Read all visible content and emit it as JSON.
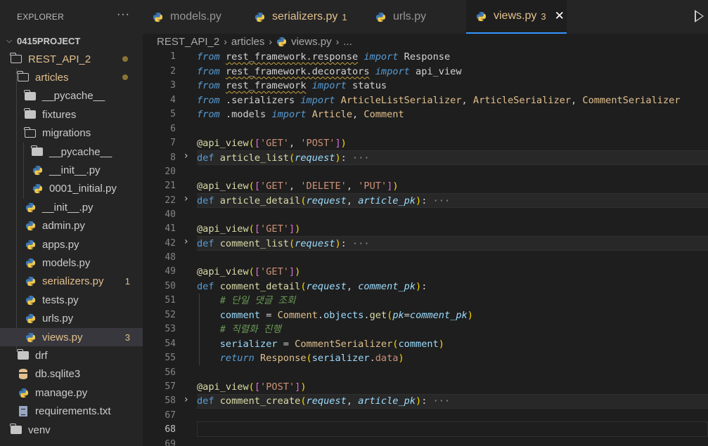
{
  "sidebar": {
    "title": "EXPLORER",
    "more": "···",
    "project": "0415PROJECT",
    "tree": [
      {
        "label": "REST_API_2",
        "type": "folder-open",
        "mod": "dot"
      },
      {
        "label": "articles",
        "type": "folder-open",
        "mod": "dot"
      },
      {
        "label": "__pycache__",
        "type": "folder"
      },
      {
        "label": "fixtures",
        "type": "folder"
      },
      {
        "label": "migrations",
        "type": "folder-open"
      },
      {
        "label": "__pycache__",
        "type": "folder"
      },
      {
        "label": "__init__.py",
        "type": "py"
      },
      {
        "label": "0001_initial.py",
        "type": "py"
      },
      {
        "label": "__init__.py",
        "type": "py"
      },
      {
        "label": "admin.py",
        "type": "py"
      },
      {
        "label": "apps.py",
        "type": "py"
      },
      {
        "label": "models.py",
        "type": "py"
      },
      {
        "label": "serializers.py",
        "type": "py",
        "badge": "1"
      },
      {
        "label": "tests.py",
        "type": "py"
      },
      {
        "label": "urls.py",
        "type": "py"
      },
      {
        "label": "views.py",
        "type": "py",
        "badge": "3"
      },
      {
        "label": "drf",
        "type": "folder"
      },
      {
        "label": "db.sqlite3",
        "type": "db"
      },
      {
        "label": "manage.py",
        "type": "py"
      },
      {
        "label": "requirements.txt",
        "type": "txt"
      },
      {
        "label": "venv",
        "type": "folder"
      }
    ]
  },
  "tabs": [
    {
      "label": "models.py"
    },
    {
      "label": "serializers.py",
      "badge": "1"
    },
    {
      "label": "urls.py"
    },
    {
      "label": "views.py",
      "badge": "3",
      "close": "✕"
    }
  ],
  "breadcrumb": {
    "parts": [
      "REST_API_2",
      "articles",
      "views.py",
      "..."
    ],
    "sep": "›"
  },
  "editor": {
    "line_numbers": [
      "1",
      "2",
      "3",
      "4",
      "5",
      "6",
      "7",
      "8",
      "20",
      "21",
      "22",
      "40",
      "41",
      "42",
      "48",
      "49",
      "50",
      "51",
      "52",
      "53",
      "54",
      "55",
      "56",
      "57",
      "58",
      "67",
      "68",
      "69"
    ],
    "folded_ellipsis": "···",
    "code": {
      "l1": {
        "a": "from",
        "b": "rest_framework.response",
        "c": "import",
        "d": "Response"
      },
      "l2": {
        "a": "from",
        "b": "rest_framework.decorators",
        "c": "import",
        "d": "api_view"
      },
      "l3": {
        "a": "from",
        "b": "rest_framework",
        "c": "import",
        "d": "status"
      },
      "l4": {
        "a": "from",
        "b": ".serializers",
        "c": "import",
        "d": "ArticleListSerializer",
        "e": "ArticleSerializer",
        "f": "CommentSerializer"
      },
      "l5": {
        "a": "from",
        "b": ".models",
        "c": "import",
        "d": "Article",
        "e": "Comment"
      },
      "dec1": {
        "name": "@api_view",
        "args": [
          "'GET'",
          "'POST'"
        ]
      },
      "def1": {
        "kw": "def",
        "name": "article_list",
        "params": [
          "request"
        ]
      },
      "dec2": {
        "name": "@api_view",
        "args": [
          "'GET'",
          "'DELETE'",
          "'PUT'"
        ]
      },
      "def2": {
        "kw": "def",
        "name": "article_detail",
        "params": [
          "request",
          "article_pk"
        ]
      },
      "dec3": {
        "name": "@api_view",
        "args": [
          "'GET'"
        ]
      },
      "def3": {
        "kw": "def",
        "name": "comment_list",
        "params": [
          "request"
        ]
      },
      "dec4": {
        "name": "@api_view",
        "args": [
          "'GET'"
        ]
      },
      "def4": {
        "kw": "def",
        "name": "comment_detail",
        "params": [
          "request",
          "comment_pk"
        ]
      },
      "c1": "# 단일 댓글 조회",
      "s1": {
        "var": "comment",
        "cls": "Comment",
        "attr": "objects",
        "fn": "get",
        "kw": "pk",
        "val": "comment_pk"
      },
      "c2": "# 직렬화 진행",
      "s2": {
        "var": "serializer",
        "cls": "CommentSerializer",
        "arg": "comment"
      },
      "s3": {
        "kw": "return",
        "cls": "Response",
        "obj": "serializer",
        "attr": "data"
      },
      "dec5": {
        "name": "@api_view",
        "args": [
          "'POST'"
        ]
      },
      "def5": {
        "kw": "def",
        "name": "comment_create",
        "params": [
          "request",
          "article_pk"
        ]
      }
    }
  }
}
